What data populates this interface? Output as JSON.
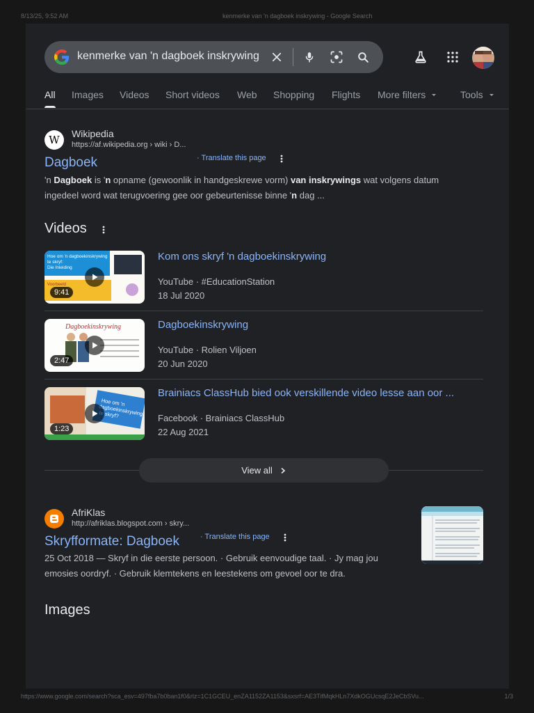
{
  "print": {
    "date": "8/13/25, 9:52 AM",
    "title": "kenmerke van 'n dagboek inskrywing - Google Search",
    "url": "https://www.google.com/search?sca_esv=497fba7b0ban1f0&rlz=1C1GCEU_enZA1152ZA1153&sxsrf=AE3TifMqkHLn7XdkOGUcsqE2JeCbSVu...",
    "page": "1/3"
  },
  "search": {
    "query": "kenmerke van 'n dagboek inskrywing"
  },
  "tabs": [
    "All",
    "Images",
    "Videos",
    "Short videos",
    "Web",
    "Shopping",
    "Flights",
    "More filters",
    "Tools"
  ],
  "results": [
    {
      "site": "Wikipedia",
      "url": "https://af.wikipedia.org › wiki › D...",
      "translate": "Translate this page",
      "title": "Dagboek"
    },
    {
      "site": "AfriKlas",
      "url": "http://afriklas.blogspot.com › skry...",
      "translate": "Translate this page",
      "title": "Skryfformate: Dagboek",
      "date": "25 Oct 2018",
      "snippet_line1": " — Skryf in die eerste persoon. · Gebruik eenvoudige taal. · Jy mag jou",
      "snippet_line2": "emosies oordryf. · Gebruik klemtekens en leestekens om gevoel oor te dra."
    }
  ],
  "wiki_snippet": {
    "p1": "'n ",
    "b1": "Dagboek",
    "p2": " is '",
    "b2": "n",
    "p3": " opname (gewoonlik in handgeskrewe vorm) ",
    "b3": "van inskrywings",
    "p4": " wat volgens datum",
    "line2a": "ingedeel word wat terugvoering gee oor gebeurtenisse binne '",
    "b4": "n",
    "line2b": " dag ..."
  },
  "videos_section": {
    "heading": "Videos",
    "items": [
      {
        "title": "Kom ons skryf 'n dagboekinskrywing",
        "source": "YouTube · #EducationStation",
        "date": "18 Jul 2020",
        "duration": "9:41"
      },
      {
        "title": "Dagboekinskrywing",
        "source": "YouTube · Rolien Viljoen",
        "date": "20 Jun 2020",
        "duration": "2:47"
      },
      {
        "title": "Brainiacs ClassHub bied ook verskillende video lesse aan oor ...",
        "source": "Facebook · Brainiacs ClassHub",
        "date": "22 Aug 2021",
        "duration": "1:23"
      }
    ],
    "view_all": "View all"
  },
  "images_section": {
    "heading": "Images"
  },
  "thumb_text": {
    "t1_line1": "Hoe om 'n dagboekinskrywing",
    "t1_line2": "te skryf:",
    "t1_line3": "Die Inleiding",
    "t1_line4": "Voorbeeld",
    "t2_title": "Dagboekinskrywing",
    "t3_line1": "Hoe om 'n",
    "t3_line2": "dagboekinskrywing",
    "t3_line3": "te skryf?"
  },
  "colors": {
    "link": "#8ab4f8",
    "page_bg": "#202124",
    "searchbar_bg": "#4d5156"
  }
}
